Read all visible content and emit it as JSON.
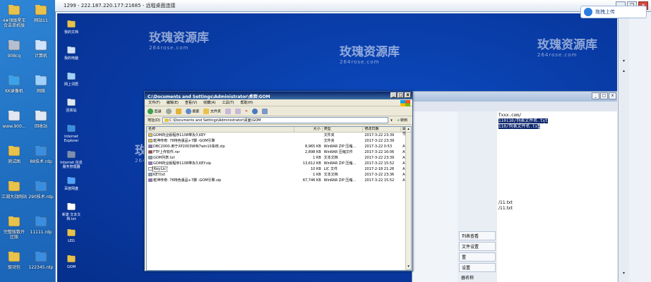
{
  "outer_desktop": {
    "icons": [
      {
        "label": "4#顶级星王 合击单机版",
        "icon": "folder-icon",
        "color": "#e8c24a"
      },
      {
        "label": "网站11",
        "icon": "folder-icon",
        "color": "#e8c24a"
      },
      {
        "label": "908cq",
        "icon": "zip-icon",
        "color": "#b5bfd0"
      },
      {
        "label": "计算机",
        "icon": "computer-icon",
        "color": "#cfe3ff"
      },
      {
        "label": "KK录像机",
        "icon": "camera-icon",
        "color": "#3aa2e8"
      },
      {
        "label": "网络",
        "icon": "network-icon",
        "color": "#9fd0ff"
      },
      {
        "label": "www.900...",
        "icon": "document-icon",
        "color": "#e0e7f2"
      },
      {
        "label": "回收站",
        "icon": "recycle-bin-icon",
        "color": "#dfe8f3"
      },
      {
        "label": "测试图",
        "icon": "folder-icon",
        "color": "#e8c24a"
      },
      {
        "label": "88技术.rdp",
        "icon": "rdp-icon",
        "color": "#3a8ee0"
      },
      {
        "label": "江湖大战网站",
        "icon": "folder-icon",
        "color": "#e8c24a"
      },
      {
        "label": "290技术.rdp",
        "icon": "rdp-icon",
        "color": "#3a8ee0"
      },
      {
        "label": "完整版数开 区版",
        "icon": "folder-icon",
        "color": "#e8c24a"
      },
      {
        "label": "11111.rdp",
        "icon": "rdp-icon",
        "color": "#3a8ee0"
      },
      {
        "label": "驱动包",
        "icon": "folder-icon",
        "color": "#e8c24a"
      },
      {
        "label": "122345.rdp",
        "icon": "rdp-icon",
        "color": "#3a8ee0"
      }
    ]
  },
  "remote_window": {
    "title": "1299 - 222.187.220.177:21685 - 远程桌面连接",
    "controls": {
      "minimize": "—",
      "restore": "❐",
      "close": "✕"
    }
  },
  "pinned_toolbar": {
    "label": "拖拽上传"
  },
  "remote_desktop": {
    "icons": [
      {
        "label": "我的文档",
        "icon": "documents-folder-icon",
        "color": "#e8c24a"
      },
      {
        "label": "我的电脑",
        "icon": "computer-icon",
        "color": "#cfe3ff"
      },
      {
        "label": "网上邻居",
        "icon": "network-icon",
        "color": "#9fd0ff"
      },
      {
        "label": "回收站",
        "icon": "recycle-bin-icon",
        "color": "#dfe8f3"
      },
      {
        "label": "Internet Explorer",
        "icon": "ie-icon",
        "color": "#3a8ee0"
      },
      {
        "label": "Internet 信息服务管理器",
        "icon": "iis-icon",
        "color": "#7b8fb0"
      },
      {
        "label": "百度网盘",
        "icon": "cloud-icon",
        "color": "#4da3ff"
      },
      {
        "label": "新建 文本文档.txt",
        "icon": "text-file-icon",
        "color": "#ffffff"
      },
      {
        "label": "LEG",
        "icon": "folder-icon",
        "color": "#e8c24a"
      },
      {
        "label": "GOM",
        "icon": "folder-icon",
        "color": "#e8c24a"
      }
    ]
  },
  "background_window": {
    "text_lines": [
      {
        "text": "Txxx.com/",
        "highlight": false
      },
      {
        "text": "110110/列表文件名.txt",
        "highlight": true
      },
      {
        "text": "110/列表文件名.txt",
        "highlight": true
      }
    ],
    "side_buttons": [
      "列表查看",
      "文件设置",
      "置",
      "设置"
    ],
    "right_labels": [
      "/11.txt",
      "/11.txt"
    ],
    "bottom_label": "器名称"
  },
  "explorer": {
    "title": "C:\\Documents and Settings\\Administrator\\桌面\\GOM",
    "menu": [
      "文件(F)",
      "编辑(E)",
      "查看(V)",
      "收藏(A)",
      "工具(T)",
      "帮助(H)"
    ],
    "toolbar": {
      "back": "后退",
      "search": "搜索",
      "folders": "文件夹"
    },
    "address_label": "地址(D)",
    "address_value": "C:\\Documents and Settings\\Administrator\\桌面\\GOM",
    "go_label": "转到",
    "columns": {
      "name": "名称",
      "size": "大小",
      "type": "类型",
      "date": "修改日期",
      "attr": "属性"
    },
    "files": [
      {
        "name": "GOM商业版程序1108带永久KEY",
        "size": "",
        "type": "文件夹",
        "date": "2017-3-22 23:39",
        "attr": "",
        "icon": "folder-icon",
        "icolor": "#e8c24a",
        "selected": false
      },
      {
        "name": "乾坤传奇: 76特色版品+7脚 -GOM引擎",
        "size": "",
        "type": "文件夹",
        "date": "2017-3-22 23:39",
        "attr": "",
        "icon": "folder-icon",
        "icolor": "#e8c24a",
        "selected": false
      },
      {
        "name": "DBC2000-用于XP2003WIN7win10系统.zip",
        "size": "8,965 KB",
        "type": "WinRAR ZIP 压缩...",
        "date": "2017-3-22 0:53",
        "attr": "A",
        "icon": "zip-icon",
        "icolor": "#9b6bd0",
        "selected": false
      },
      {
        "name": "FTP上传软件.rar",
        "size": "2,898 KB",
        "type": "WinRAR 压缩文件",
        "date": "2017-3-22 16:06",
        "attr": "A",
        "icon": "rar-icon",
        "icolor": "#b3423a",
        "selected": false
      },
      {
        "name": "GOM列表.txt",
        "size": "1 KB",
        "type": "文本文档",
        "date": "2017-3-22 23:39",
        "attr": "A",
        "icon": "text-file-icon",
        "icolor": "#8aa0c0",
        "selected": false
      },
      {
        "name": "GOM商业版程序1108带永久KEY.zip",
        "size": "13,612 KB",
        "type": "WinRAR ZIP 压缩...",
        "date": "2017-3-22 15:52",
        "attr": "A",
        "icon": "zip-icon",
        "icolor": "#9b6bd0",
        "selected": false
      },
      {
        "name": "Key.Lic",
        "size": "10 KB",
        "type": "LIC 文件",
        "date": "2017-2-18 21:26",
        "attr": "A",
        "icon": "file-icon",
        "icolor": "#ffffff",
        "selected": true
      },
      {
        "name": "KEY.txt",
        "size": "1 KB",
        "type": "文本文档",
        "date": "2017-3-22 23:36",
        "attr": "A",
        "icon": "text-file-icon",
        "icolor": "#8aa0c0",
        "selected": false
      },
      {
        "name": "乾坤传奇: 76特色版品+7脚 -GOM引擎.zip",
        "size": "67,746 KB",
        "type": "WinRAR ZIP 压缩...",
        "date": "2017-3-22 15:52",
        "attr": "A",
        "icon": "zip-icon",
        "icolor": "#9b6bd0",
        "selected": false
      }
    ]
  },
  "watermarks": [
    {
      "main": "玫瑰资源库",
      "sub": "264rose.com"
    }
  ]
}
